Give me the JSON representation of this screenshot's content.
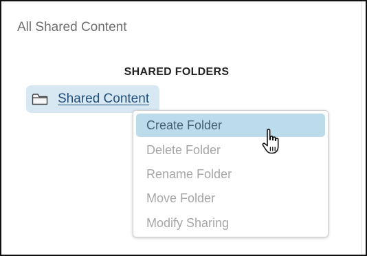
{
  "breadcrumb": "All Shared Content",
  "heading": "SHARED FOLDERS",
  "folder": {
    "label": "Shared Content",
    "icon": "folder-icon",
    "selected": true
  },
  "context_menu": {
    "items": [
      {
        "label": "Create Folder",
        "enabled": true,
        "highlighted": true
      },
      {
        "label": "Delete Folder",
        "enabled": false
      },
      {
        "label": "Rename Folder",
        "enabled": false
      },
      {
        "label": "Move Folder",
        "enabled": false
      },
      {
        "label": "Modify Sharing",
        "enabled": false
      }
    ]
  },
  "colors": {
    "folder_highlight": "#d8e8f3",
    "menu_highlight": "#bcdcec",
    "link": "#1f4e79",
    "disabled_text": "#a6a6a6"
  },
  "cursor": "hand-pointer-icon"
}
